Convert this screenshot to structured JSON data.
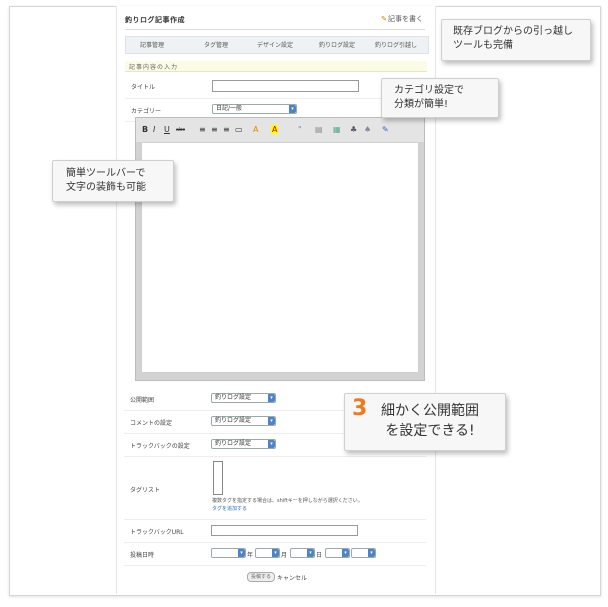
{
  "header": {
    "title": "釣りログ記事作成",
    "write_link": "記事を書く"
  },
  "tabs": [
    "記事管理",
    "タグ管理",
    "デザイン設定",
    "釣りログ設定",
    "釣りログ引越し"
  ],
  "section": {
    "label": "記事内容の入力"
  },
  "fields": {
    "title_label": "タイトル",
    "category_label": "カテゴリー",
    "category_value": "日記/一般",
    "visibility_label": "公開範囲",
    "visibility_value": "釣りログ設定",
    "comment_label": "コメントの設定",
    "comment_value": "釣りログ設定",
    "trackback_label": "トラックバックの設定",
    "trackback_value": "釣りログ設定",
    "taglist_label": "タグリスト",
    "tag_hint": "複数タグを指定する場合は、shiftキーを押しながら選択ください。",
    "tag_add": "タグを追加する",
    "trackback_url_label": "トラックバックURL",
    "post_date_label": "投稿日時",
    "date_units": [
      "年",
      "月",
      "日"
    ]
  },
  "toolbar": [
    "B",
    "I",
    "U",
    "abc",
    "≡",
    "≡",
    "≡",
    "▭",
    "A",
    "A",
    "\"",
    "▤",
    "▦",
    "♣",
    "♠",
    "✎"
  ],
  "actions": {
    "save": "投稿する",
    "cancel": "キャンセル"
  },
  "callouts": {
    "migration": "既存ブログからの引っ越し\nツールも完備",
    "category": "カテゴリ設定で\n分類が簡単!",
    "toolbar": "簡単ツールバーで\n文字の装飾も可能",
    "visibility_num": "3",
    "visibility": "細かく公開範囲\nを設定できる!"
  },
  "colors": {
    "accent": "#f07a1a",
    "select_arrow": "#4d83c9"
  }
}
